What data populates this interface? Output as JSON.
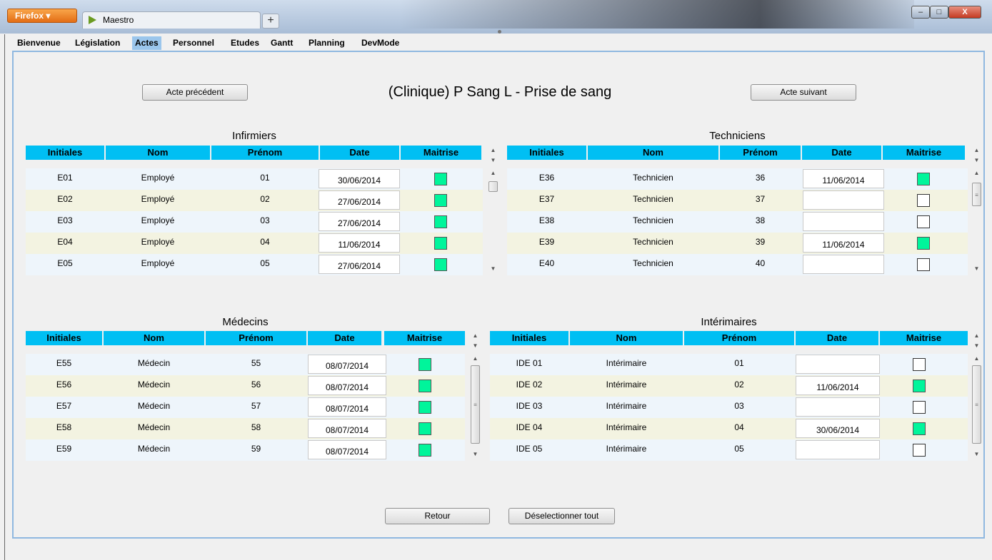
{
  "browser": {
    "menu_button": "Firefox",
    "tab_title": "Maestro",
    "new_tab": "+",
    "min": "–",
    "max": "□",
    "close": "X"
  },
  "menu": [
    "Bienvenue",
    "Législation",
    "Actes",
    "Personnel",
    "Etudes",
    "Gantt",
    "Planning",
    "DevMode"
  ],
  "active_menu": "Actes",
  "page": {
    "title": "(Clinique) P Sang L - Prise de sang",
    "prev_button": "Acte précédent",
    "next_button": "Acte suivant",
    "back_button": "Retour",
    "deselect_button": "Déselectionner tout"
  },
  "columns": {
    "initials": "Initiales",
    "name": "Nom",
    "firstname": "Prénom",
    "date": "Date",
    "mastery": "Maitrise"
  },
  "tables": {
    "nurses": {
      "title": "Infirmiers",
      "rows": [
        {
          "initials": "E01",
          "name": "Employé",
          "firstname": "01",
          "date": "30/06/2014",
          "mastery": true
        },
        {
          "initials": "E02",
          "name": "Employé",
          "firstname": "02",
          "date": "27/06/2014",
          "mastery": true
        },
        {
          "initials": "E03",
          "name": "Employé",
          "firstname": "03",
          "date": "27/06/2014",
          "mastery": true
        },
        {
          "initials": "E04",
          "name": "Employé",
          "firstname": "04",
          "date": "11/06/2014",
          "mastery": true
        },
        {
          "initials": "E05",
          "name": "Employé",
          "firstname": "05",
          "date": "27/06/2014",
          "mastery": true
        }
      ]
    },
    "technicians": {
      "title": "Techniciens",
      "rows": [
        {
          "initials": "E36",
          "name": "Technicien",
          "firstname": "36",
          "date": "11/06/2014",
          "mastery": true
        },
        {
          "initials": "E37",
          "name": "Technicien",
          "firstname": "37",
          "date": "",
          "mastery": false
        },
        {
          "initials": "E38",
          "name": "Technicien",
          "firstname": "38",
          "date": "",
          "mastery": false
        },
        {
          "initials": "E39",
          "name": "Technicien",
          "firstname": "39",
          "date": "11/06/2014",
          "mastery": true
        },
        {
          "initials": "E40",
          "name": "Technicien",
          "firstname": "40",
          "date": "",
          "mastery": false
        }
      ]
    },
    "doctors": {
      "title": "Médecins",
      "rows": [
        {
          "initials": "E55",
          "name": "Médecin",
          "firstname": "55",
          "date": "08/07/2014",
          "mastery": true
        },
        {
          "initials": "E56",
          "name": "Médecin",
          "firstname": "56",
          "date": "08/07/2014",
          "mastery": true
        },
        {
          "initials": "E57",
          "name": "Médecin",
          "firstname": "57",
          "date": "08/07/2014",
          "mastery": true
        },
        {
          "initials": "E58",
          "name": "Médecin",
          "firstname": "58",
          "date": "08/07/2014",
          "mastery": true
        },
        {
          "initials": "E59",
          "name": "Médecin",
          "firstname": "59",
          "date": "08/07/2014",
          "mastery": true
        }
      ]
    },
    "temps": {
      "title": "Intérimaires",
      "rows": [
        {
          "initials": "IDE 01",
          "name": "Intérimaire",
          "firstname": "01",
          "date": "",
          "mastery": false
        },
        {
          "initials": "IDE 02",
          "name": "Intérimaire",
          "firstname": "02",
          "date": "11/06/2014",
          "mastery": true
        },
        {
          "initials": "IDE 03",
          "name": "Intérimaire",
          "firstname": "03",
          "date": "",
          "mastery": false
        },
        {
          "initials": "IDE 04",
          "name": "Intérimaire",
          "firstname": "04",
          "date": "30/06/2014",
          "mastery": true
        },
        {
          "initials": "IDE 05",
          "name": "Intérimaire",
          "firstname": "05",
          "date": "",
          "mastery": false
        }
      ]
    }
  },
  "colors": {
    "header": "#00bff3",
    "mastery_on": "#00f59b",
    "row_even": "#eef5fb",
    "row_odd": "#f3f3e1",
    "accent_border": "#8fb8e0"
  }
}
